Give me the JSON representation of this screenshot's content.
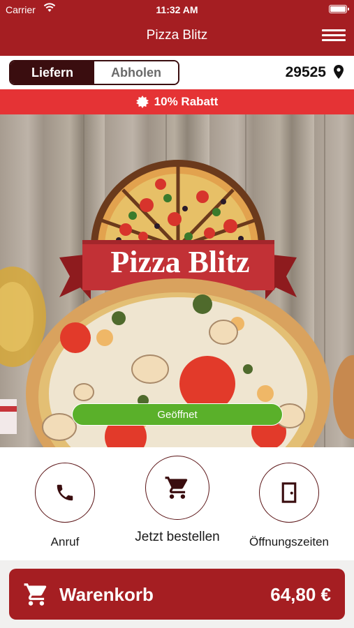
{
  "status_bar": {
    "carrier": "Carrier",
    "time": "11:32 AM"
  },
  "nav": {
    "title": "Pizza Blitz"
  },
  "delivery": {
    "deliver_label": "Liefern",
    "pickup_label": "Abholen",
    "active": "deliver",
    "postal_code": "29525"
  },
  "banner": {
    "text": "10% Rabatt"
  },
  "hero": {
    "logo_text": "Pizza Blitz",
    "status": "Geöffnet"
  },
  "actions": {
    "call": "Anruf",
    "order": "Jetzt bestellen",
    "hours": "Öffnungszeiten"
  },
  "cart": {
    "label": "Warenkorb",
    "total": "64,80 €"
  },
  "colors": {
    "brand": "#a51e22",
    "banner": "#e53335",
    "dark": "#3a0d0f",
    "open": "#5ab02a"
  }
}
